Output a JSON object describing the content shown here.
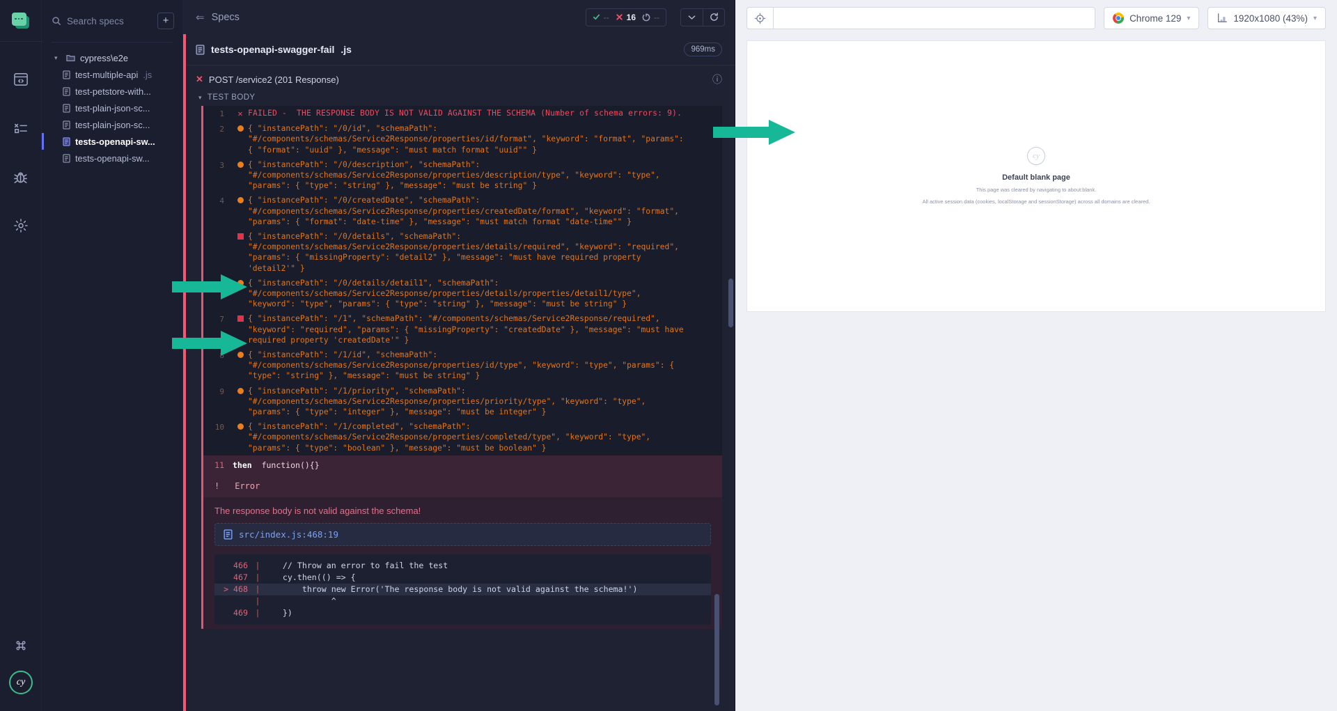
{
  "rail": {
    "logo_name": "cypress-logo",
    "items": [
      {
        "name": "runs-icon",
        "glyph": "browser-code"
      },
      {
        "name": "specs-icon",
        "glyph": "list"
      },
      {
        "name": "debug-icon",
        "glyph": "bug"
      },
      {
        "name": "settings-icon",
        "glyph": "gear"
      }
    ],
    "bottom": [
      {
        "name": "keyboard-shortcuts-icon",
        "glyph": "command"
      },
      {
        "name": "cypress-account-badge",
        "label": "cy"
      }
    ]
  },
  "specs_panel": {
    "search_placeholder": "Search specs",
    "add_button_label": "+",
    "tree": [
      {
        "type": "folder",
        "label": "cypress\\e2e",
        "expanded": true
      },
      {
        "type": "file",
        "label": "test-multiple-api",
        "ext": ".js",
        "selected": false
      },
      {
        "type": "file",
        "label": "test-petstore-with...",
        "ext": "",
        "selected": false
      },
      {
        "type": "file",
        "label": "test-plain-json-sc...",
        "ext": "",
        "selected": false
      },
      {
        "type": "file",
        "label": "test-plain-json-sc...",
        "ext": "",
        "selected": false
      },
      {
        "type": "file",
        "label": "tests-openapi-sw...",
        "ext": "",
        "selected": true
      },
      {
        "type": "file",
        "label": "tests-openapi-sw...",
        "ext": "",
        "selected": false
      }
    ]
  },
  "reporter": {
    "header": {
      "back_label": "Specs",
      "stats": [
        {
          "name": "passed",
          "icon": "check",
          "value": "--"
        },
        {
          "name": "failed",
          "icon": "cross",
          "value": "16"
        },
        {
          "name": "pending",
          "icon": "circle-dashed",
          "value": "--"
        }
      ],
      "controls": [
        {
          "name": "chevron-down-button",
          "glyph": "v"
        },
        {
          "name": "restart-button",
          "glyph": "refresh"
        }
      ]
    },
    "spec": {
      "name": "tests-openapi-swagger-fail",
      "ext": ".js",
      "duration": "969ms"
    },
    "test": {
      "title": "POST /service2 (201 Response)",
      "body_label": "TEST BODY",
      "lines": [
        {
          "num": "1",
          "marker": "x",
          "kind": "failed",
          "text": "FAILED -  THE RESPONSE BODY IS NOT VALID AGAINST THE SCHEMA (Number of schema errors: 9)."
        },
        {
          "num": "2",
          "marker": "dot",
          "kind": "normal",
          "text": "{ \"instancePath\": \"/0/id\", \"schemaPath\":\n\"#/components/schemas/Service2Response/properties/id/format\", \"keyword\": \"format\", \"params\":\n{ \"format\": \"uuid\" }, \"message\": \"must match format \"uuid\"\" }"
        },
        {
          "num": "3",
          "marker": "dot",
          "kind": "normal",
          "text": "{ \"instancePath\": \"/0/description\", \"schemaPath\":\n\"#/components/schemas/Service2Response/properties/description/type\", \"keyword\": \"type\",\n\"params\": { \"type\": \"string\" }, \"message\": \"must be string\" }"
        },
        {
          "num": "4",
          "marker": "dot",
          "kind": "normal",
          "text": "{ \"instancePath\": \"/0/createdDate\", \"schemaPath\":\n\"#/components/schemas/Service2Response/properties/createdDate/format\", \"keyword\": \"format\",\n\"params\": { \"format\": \"date-time\" }, \"message\": \"must match format \"date-time\"\" }"
        },
        {
          "num": "",
          "marker": "square",
          "kind": "normal",
          "text": "{ \"instancePath\": \"/0/details\", \"schemaPath\":\n\"#/components/schemas/Service2Response/properties/details/required\", \"keyword\": \"required\",\n\"params\": { \"missingProperty\": \"detail2\" }, \"message\": \"must have required property\n'detail2'\" }"
        },
        {
          "num": "",
          "marker": "dot",
          "kind": "normal",
          "text": "{ \"instancePath\": \"/0/details/detail1\", \"schemaPath\":\n\"#/components/schemas/Service2Response/properties/details/properties/detail1/type\",\n\"keyword\": \"type\", \"params\": { \"type\": \"string\" }, \"message\": \"must be string\" }"
        },
        {
          "num": "7",
          "marker": "square",
          "kind": "normal",
          "text": "{ \"instancePath\": \"/1\", \"schemaPath\": \"#/components/schemas/Service2Response/required\",\n\"keyword\": \"required\", \"params\": { \"missingProperty\": \"createdDate\" }, \"message\": \"must have\nrequired property 'createdDate'\" }"
        },
        {
          "num": "8",
          "marker": "dot",
          "kind": "normal",
          "text": "{ \"instancePath\": \"/1/id\", \"schemaPath\":\n\"#/components/schemas/Service2Response/properties/id/type\", \"keyword\": \"type\", \"params\": {\n\"type\": \"string\" }, \"message\": \"must be string\" }"
        },
        {
          "num": "9",
          "marker": "dot",
          "kind": "normal",
          "text": "{ \"instancePath\": \"/1/priority\", \"schemaPath\":\n\"#/components/schemas/Service2Response/properties/priority/type\", \"keyword\": \"type\",\n\"params\": { \"type\": \"integer\" }, \"message\": \"must be integer\" }"
        },
        {
          "num": "10",
          "marker": "dot",
          "kind": "normal",
          "text": "{ \"instancePath\": \"/1/completed\", \"schemaPath\":\n\"#/components/schemas/Service2Response/properties/completed/type\", \"keyword\": \"type\",\n\"params\": { \"type\": \"boolean\" }, \"message\": \"must be boolean\" }"
        }
      ],
      "then_line": {
        "num": "11",
        "keyword": "then",
        "code": "function(){}"
      }
    },
    "error": {
      "badge": "!",
      "title": "Error",
      "message": "The response body is not valid against the schema!",
      "file_link": "src/index.js:468:19",
      "code_frame": [
        {
          "num": "466",
          "marker": "",
          "text": "    // Throw an error to fail the test",
          "highlight": false
        },
        {
          "num": "467",
          "marker": "",
          "text": "    cy.then(() => {",
          "highlight": false
        },
        {
          "num": "468",
          "marker": ">",
          "text": "        throw new Error('The response body is not valid against the schema!')",
          "highlight": true
        },
        {
          "num": "",
          "marker": "",
          "text": "              ^",
          "highlight": false
        },
        {
          "num": "469",
          "marker": "",
          "text": "    })",
          "highlight": false
        }
      ]
    }
  },
  "aut": {
    "selector_playground_icon": "crosshair-icon",
    "url_value": "",
    "url_placeholder": "",
    "browser": {
      "label": "Chrome 129",
      "icon": "chrome-icon"
    },
    "viewport": {
      "label": "1920x1080 (43%)",
      "icon": "viewport-icon"
    },
    "blank_page": {
      "logo": "cy",
      "title": "Default blank page",
      "line1": "This page was cleared by navigating to about:blank.",
      "line2": "All active session data (cookies, localStorage and sessionStorage) across all domains are cleared."
    }
  },
  "annotations": {
    "arrow_color": "#16b898",
    "arrows": [
      {
        "name": "arrow-to-failed-line",
        "target": "failed-summary-line"
      },
      {
        "name": "arrow-to-details-required-line",
        "target": "schema-error-details-required"
      },
      {
        "name": "arrow-to-detail1-type-line",
        "target": "schema-error-detail1-type"
      }
    ]
  }
}
